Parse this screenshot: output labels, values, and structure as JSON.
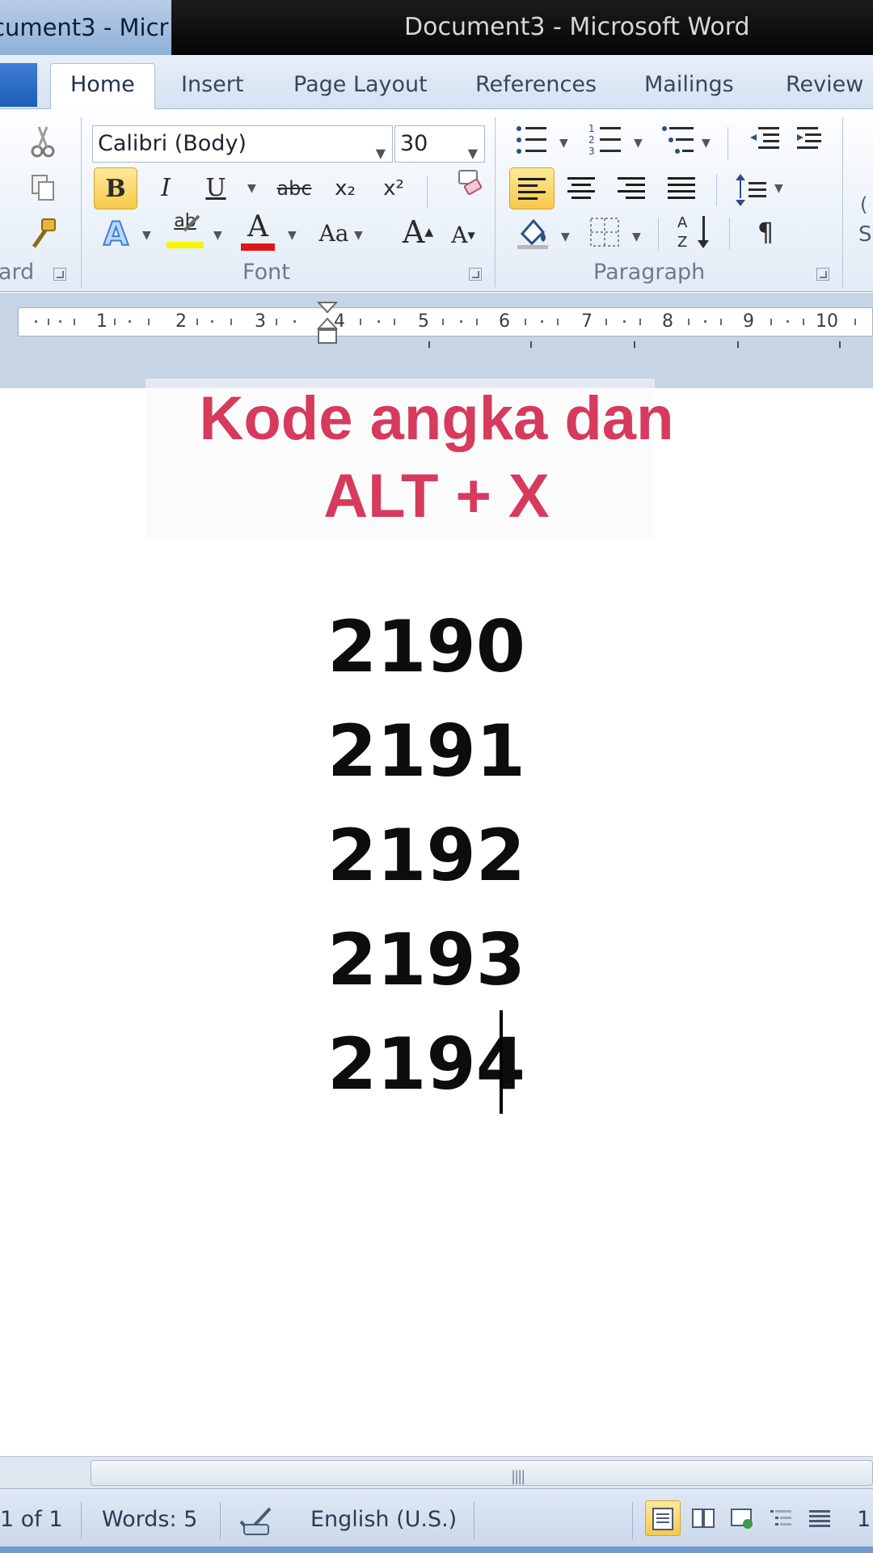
{
  "titlebar": {
    "taskbar_button": "cument3 - Micr",
    "window_title": "Document3  -  Microsoft Word"
  },
  "ribbon_tabs": {
    "home": "Home",
    "insert": "Insert",
    "page_layout": "Page Layout",
    "references": "References",
    "mailings": "Mailings",
    "review": "Review"
  },
  "clipboard": {
    "label": "ard"
  },
  "font": {
    "name": "Calibri (Body)",
    "size": "30",
    "label": "Font",
    "bold": "B",
    "italic": "I",
    "underline": "U",
    "strikethrough": "abc",
    "subscript": "x₂",
    "superscript": "x²",
    "change_case": "Aa",
    "grow": "A",
    "shrink": "A",
    "color_letter": "A",
    "highlight": "ab"
  },
  "paragraph": {
    "label": "Paragraph",
    "pilcrow": "¶"
  },
  "styles_partial": {
    "top": "(",
    "bottom": "S"
  },
  "ruler": {
    "numbers": [
      "1",
      "2",
      "3",
      "4",
      "5",
      "6",
      "7",
      "8",
      "9",
      "10"
    ]
  },
  "overlay": {
    "line1": "Kode angka dan",
    "line2": "ALT + X"
  },
  "document": {
    "lines": [
      "2190",
      "2191",
      "2192",
      "2193",
      "2194"
    ]
  },
  "statusbar": {
    "page": "1 of 1",
    "words": "Words: 5",
    "language": "English (U.S.)",
    "zoom_partial": "1"
  },
  "colors": {
    "overlay_text": "#d63a5c",
    "font_color_bar": "#e0161b",
    "highlight_bar": "#f5f500",
    "active_button": "#f6c94c"
  }
}
